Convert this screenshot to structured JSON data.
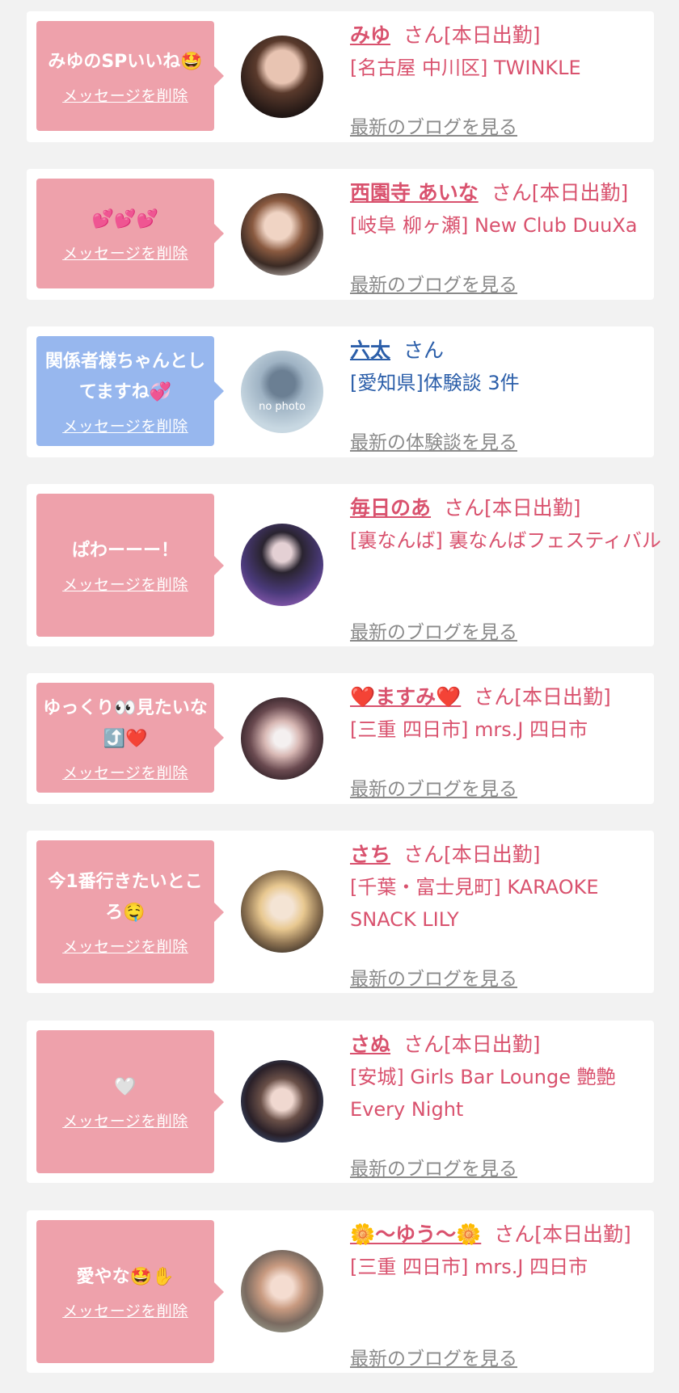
{
  "colors": {
    "pink_bubble": "#eea1ab",
    "blue_bubble": "#97b7ee",
    "pink_text": "#d9526e",
    "blue_text": "#2b5ea9",
    "link_gray": "#8a8a8a"
  },
  "cards": [
    {
      "message": "みゆのSPいいね🤩",
      "delete_label": "メッセージを削除",
      "name": "みゆ",
      "suffix": "さん[本日出勤]",
      "shop": "[名古屋 中川区] TWINKLE",
      "link": "最新のブログを見る"
    },
    {
      "message": "💕💕💕",
      "delete_label": "メッセージを削除",
      "name": "西園寺 あいな",
      "suffix": "さん[本日出勤]",
      "shop": "[岐阜 柳ヶ瀬] New Club DuuXa",
      "link": "最新のブログを見る"
    },
    {
      "message": "関係者様ちゃんとしてますね💞",
      "delete_label": "メッセージを削除",
      "name": "六太",
      "suffix": "さん",
      "shop": "[愛知県]体験談 3件",
      "link": "最新の体験談を見る",
      "avatar_text": "no photo"
    },
    {
      "message": "ぱわーーー！",
      "delete_label": "メッセージを削除",
      "name": "毎日のあ",
      "suffix": "さん[本日出勤]",
      "shop": "[裏なんば] 裏なんばフェスティバル",
      "link": "最新のブログを見る"
    },
    {
      "message": "ゆっくり👀見たいな⤴️❤️",
      "delete_label": "メッセージを削除",
      "name": "❤️ますみ❤️",
      "suffix": "さん[本日出勤]",
      "shop": "[三重 四日市] mrs.J 四日市",
      "link": "最新のブログを見る"
    },
    {
      "message": "今1番行きたいところ🤤",
      "delete_label": "メッセージを削除",
      "name": "さち",
      "suffix": "さん[本日出勤]",
      "shop": "[千葉・富士見町] KARAOKE SNACK LILY",
      "link": "最新のブログを見る"
    },
    {
      "message": "🤍",
      "delete_label": "メッセージを削除",
      "name": "さぬ",
      "suffix": "さん[本日出勤]",
      "shop": "[安城] Girls Bar Lounge 艶艶 Every Night",
      "link": "最新のブログを見る"
    },
    {
      "message": "愛やな🤩✋",
      "delete_label": "メッセージを削除",
      "name": "🌼〜ゆう〜🌼",
      "suffix": "さん[本日出勤]",
      "shop": "[三重 四日市] mrs.J 四日市",
      "link": "最新のブログを見る"
    }
  ]
}
